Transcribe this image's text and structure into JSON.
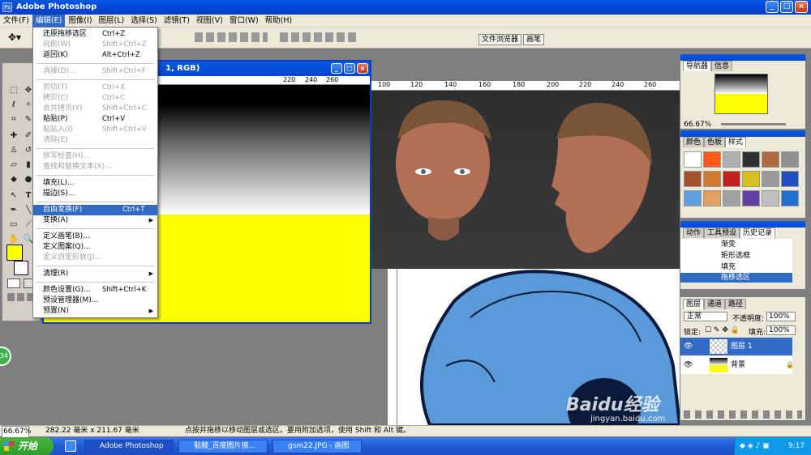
{
  "app": {
    "title": "Adobe Photoshop"
  },
  "menubar": [
    "文件(F)",
    "编辑(E)",
    "图像(I)",
    "图层(L)",
    "选择(S)",
    "滤镜(T)",
    "视图(V)",
    "窗口(W)",
    "帮助(H)"
  ],
  "dock_tabs": [
    "文件浏览器",
    "画笔"
  ],
  "edit_menu": [
    {
      "label": "还原拖移选区",
      "shortcut": "Ctrl+Z",
      "disabled": false
    },
    {
      "label": "向前(W)",
      "shortcut": "Shift+Ctrl+Z",
      "disabled": true
    },
    {
      "label": "返回(K)",
      "shortcut": "Alt+Ctrl+Z",
      "disabled": false
    },
    {
      "label": "消褪(D)...",
      "shortcut": "Shift+Ctrl+F",
      "disabled": true
    },
    {
      "label": "剪切(T)",
      "shortcut": "Ctrl+X",
      "disabled": true
    },
    {
      "label": "拷贝(C)",
      "shortcut": "Ctrl+C",
      "disabled": true
    },
    {
      "label": "合并拷贝(Y)",
      "shortcut": "Shift+Ctrl+C",
      "disabled": true
    },
    {
      "label": "粘贴(P)",
      "shortcut": "Ctrl+V",
      "disabled": false
    },
    {
      "label": "粘贴入(I)",
      "shortcut": "Shift+Ctrl+V",
      "disabled": true
    },
    {
      "label": "清除(E)",
      "shortcut": "",
      "disabled": true
    },
    {
      "label": "拼写检查(H)...",
      "shortcut": "",
      "disabled": true
    },
    {
      "label": "查找和替换文本(X)...",
      "shortcut": "",
      "disabled": true
    },
    {
      "label": "填充(L)...",
      "shortcut": "",
      "disabled": false
    },
    {
      "label": "描边(S)...",
      "shortcut": "",
      "disabled": false
    },
    {
      "label": "自由变换(F)",
      "shortcut": "Ctrl+T",
      "disabled": false,
      "selected": true
    },
    {
      "label": "变换(A)",
      "shortcut": "",
      "disabled": false,
      "submenu": true
    },
    {
      "label": "定义画笔(B)...",
      "shortcut": "",
      "disabled": false
    },
    {
      "label": "定义图案(Q)...",
      "shortcut": "",
      "disabled": false
    },
    {
      "label": "定义自定形状(J)...",
      "shortcut": "",
      "disabled": true
    },
    {
      "label": "清理(R)",
      "shortcut": "",
      "disabled": false,
      "submenu": true
    },
    {
      "label": "颜色设置(G)...",
      "shortcut": "Shift+Ctrl+K",
      "disabled": false
    },
    {
      "label": "预设管理器(M)...",
      "shortcut": "",
      "disabled": false
    },
    {
      "label": "预置(N)",
      "shortcut": "",
      "disabled": false,
      "submenu": true
    }
  ],
  "doc1": {
    "title": "1, RGB)",
    "ruler_ticks": [
      "220",
      "240",
      "260"
    ]
  },
  "doc2": {
    "ruler_ticks": [
      "100",
      "120",
      "140",
      "160",
      "180",
      "200",
      "220",
      "240",
      "260"
    ]
  },
  "navigator": {
    "tabs": [
      "导航器",
      "信息"
    ],
    "zoom": "66.67%"
  },
  "styles": {
    "tabs": [
      "颜色",
      "色板",
      "样式"
    ]
  },
  "history": {
    "tabs": [
      "动作",
      "工具预设",
      "历史记录"
    ],
    "items": [
      "渐变",
      "矩形选框",
      "填充",
      "拖移选区"
    ]
  },
  "layers": {
    "tabs": [
      "图层",
      "通道",
      "路径"
    ],
    "blend_mode": "正常",
    "opacity_label": "不透明度:",
    "opacity": "100%",
    "lock_label": "锁定:",
    "fill_label": "填充:",
    "fill": "100%",
    "items": [
      "图层 1",
      "背景"
    ]
  },
  "status": {
    "zoom": "66.67%",
    "size": "282.22 毫米 x 211.67 毫米",
    "hint": "点按并拖移以移动图层或选区。要用附加选项，使用 Shift 和 Alt 键。"
  },
  "taskbar": {
    "start": "开始",
    "tasks": [
      "Adobe Photoshop",
      "骷髅_百度图片搜...",
      "gsm22.JPG - 画图"
    ],
    "clock": "9:17"
  },
  "watermark": {
    "brand": "Baidu经验",
    "url": "jingyan.baidu.com"
  },
  "badge": "34",
  "colors": {
    "foreground": "#ffff00",
    "accent": "#316ac5",
    "skull": "#5a9ad8"
  }
}
